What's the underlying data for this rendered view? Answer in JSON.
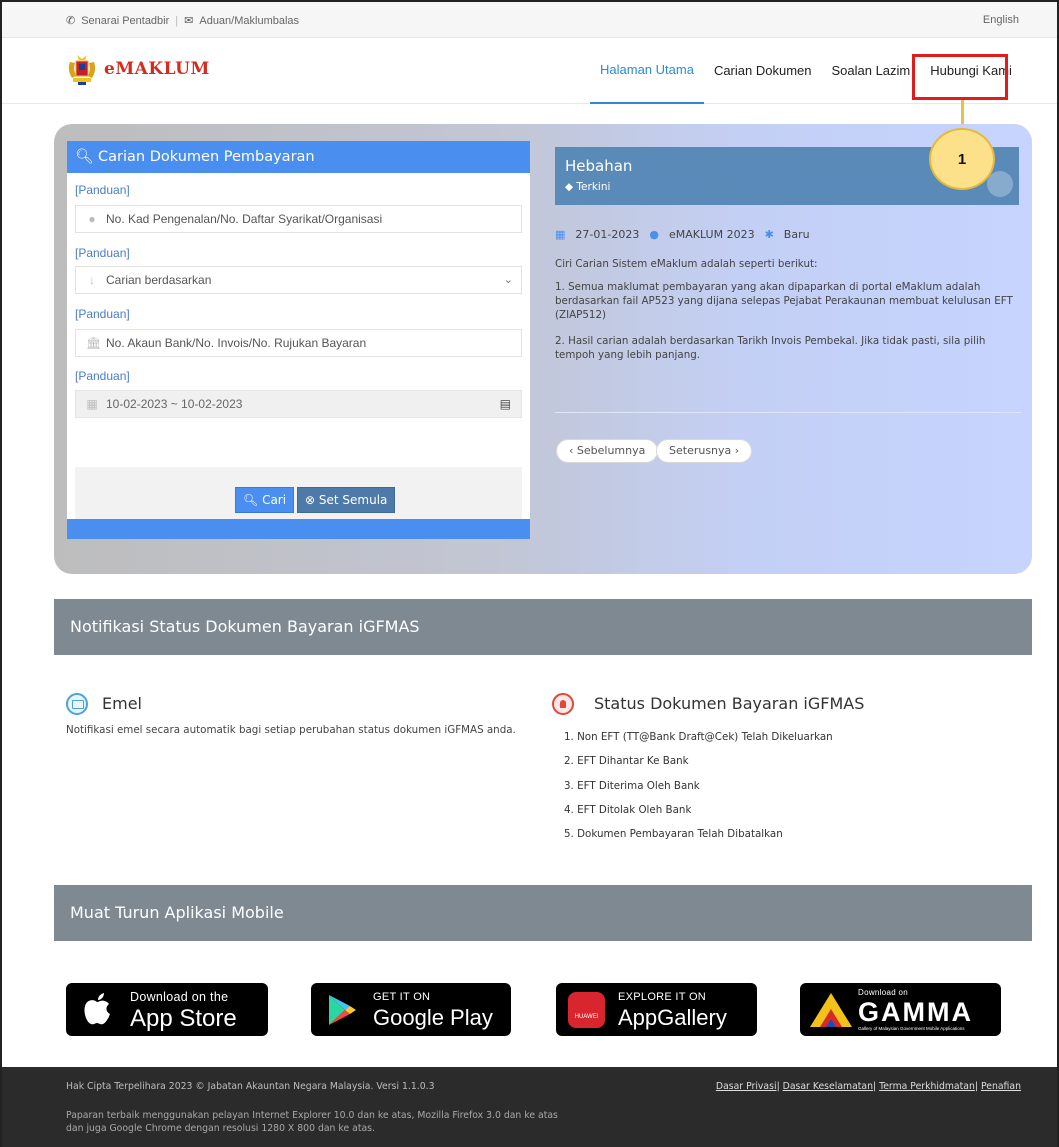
{
  "topbar": {
    "admin_list": "Senarai Pentadbir",
    "feedback": "Aduan/Maklumbalas",
    "language": "English"
  },
  "brand": {
    "logo_text": "eMAKLUM"
  },
  "nav": {
    "items": [
      "Halaman Utama",
      "Carian Dokumen",
      "Soalan Lazim",
      "Hubungi Kami"
    ],
    "active": "Halaman Utama"
  },
  "callout": {
    "number": "1"
  },
  "search_panel": {
    "title": "Carian Dokumen Pembayaran",
    "guide_label": "[Panduan]",
    "id_placeholder": "No. Kad Pengenalan/No. Daftar Syarikat/Organisasi",
    "search_by_value": "Carian berdasarkan",
    "account_placeholder": "No. Akaun Bank/No. Invois/No. Rujukan Bayaran",
    "date_range": "10-02-2023 ~ 10-02-2023",
    "search_button": "Cari",
    "reset_button": "Set Semula"
  },
  "announcement": {
    "title": "Hebahan",
    "tag": "Terkini",
    "date": "27-01-2023",
    "author": "eMAKLUM 2023",
    "status": "Baru",
    "intro": "Ciri Carian Sistem eMaklum adalah seperti berikut:",
    "point1": "1. Semua maklumat pembayaran yang akan dipaparkan di portal eMaklum adalah berdasarkan fail AP523 yang dijana selepas Pejabat Perakaunan membuat kelulusan EFT (ZIAP512)",
    "point2": "2. Hasil carian adalah berdasarkan Tarikh Invois Pembekal. Jika tidak pasti, sila pilih tempoh yang lebih panjang.",
    "prev": "‹ Sebelumnya",
    "next": "Seterusnya ›"
  },
  "notification": {
    "section_title": "Notifikasi Status Dokumen Bayaran iGFMAS",
    "email_title": "Emel",
    "email_desc": "Notifikasi emel secara automatik bagi setiap perubahan status dokumen iGFMAS anda.",
    "status_title": "Status Dokumen Bayaran iGFMAS",
    "statuses": [
      "1. Non EFT (TT@Bank Draft@Cek) Telah Dikeluarkan",
      "2. EFT Dihantar Ke Bank",
      "3. EFT Diterima Oleh Bank",
      "4. EFT Ditolak Oleh Bank",
      "5. Dokumen Pembayaran Telah Dibatalkan"
    ]
  },
  "mobile": {
    "section_title": "Muat Turun Aplikasi Mobile",
    "appstore_small": "Download on the",
    "appstore_big": "App Store",
    "googleplay_small": "GET IT ON",
    "googleplay_big": "Google Play",
    "huawei_small": "EXPLORE IT ON",
    "huawei_big": "AppGallery",
    "huawei_brand": "HUAWEI",
    "gamma_small": "Download on",
    "gamma_big": "GAMMA",
    "gamma_tagline": "Gallery of Malaysian Government Mobile Applications"
  },
  "footer": {
    "copyright": "Hak Cipta Terpelihara 2023 © Jabatan Akauntan Negara Malaysia. Versi 1.1.0.3",
    "browser_note": "Paparan terbaik menggunakan pelayan Internet Explorer 10.0 dan ke atas, Mozilla Firefox 3.0 dan ke atas dan juga Google Chrome dengan resolusi 1280 X 800 dan ke atas.",
    "links": [
      "Dasar Privasi",
      "Dasar Keselamatan",
      "Terma Perkhidmatan",
      "Penafian"
    ]
  },
  "colors": {
    "primary_blue": "#4a8ef0",
    "nav_active": "#2a8bd5",
    "section_gray": "#7f8992",
    "highlight_red": "#e21b1b",
    "callout_yellow": "#fde08a"
  }
}
